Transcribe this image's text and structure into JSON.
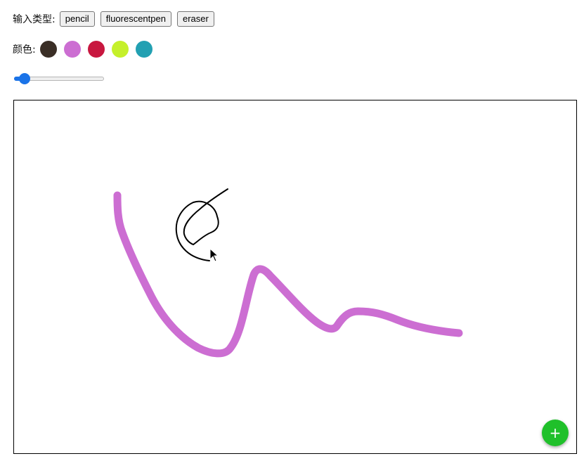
{
  "toolbar": {
    "input_type_label": "输入类型:",
    "tools": [
      {
        "label": "pencil"
      },
      {
        "label": "fluorescentpen"
      },
      {
        "label": "eraser"
      }
    ],
    "color_label": "颜色:",
    "colors": [
      {
        "name": "dark-brown",
        "hex": "#3a2e26"
      },
      {
        "name": "orchid",
        "hex": "#cc6ed2"
      },
      {
        "name": "crimson",
        "hex": "#c8173f"
      },
      {
        "name": "lime",
        "hex": "#c5f02b"
      },
      {
        "name": "teal",
        "hex": "#22a0b2"
      }
    ],
    "stroke_width_slider": {
      "value_fraction": 0.06
    }
  },
  "canvas": {
    "strokes": [
      {
        "tool": "fluorescentpen",
        "color": "#cc6ed2"
      },
      {
        "tool": "pencil",
        "color": "#000000"
      }
    ]
  },
  "fab": {
    "icon": "plus-icon",
    "label": "+",
    "color": "#1fc02a"
  }
}
